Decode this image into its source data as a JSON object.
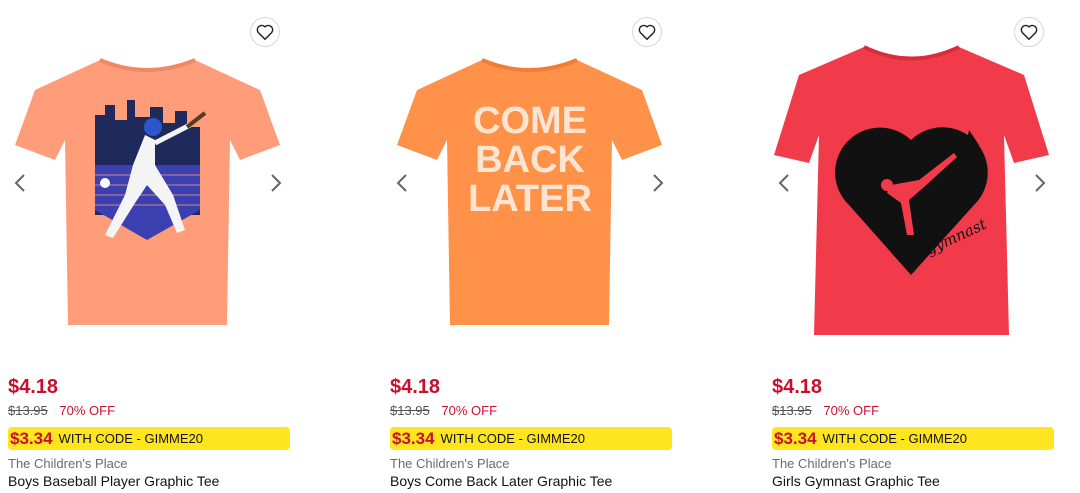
{
  "products": [
    {
      "graphic": "baseball",
      "shirt_color": "#ff9c7a",
      "price": "$4.18",
      "original_price": "$13.95",
      "discount": "70% OFF",
      "promo_price": "$3.34",
      "promo_text": "WITH CODE - GIMME20",
      "brand": "The Children's Place",
      "name": "Boys Baseball Player Graphic Tee"
    },
    {
      "graphic": "text",
      "shirt_color": "#ff9148",
      "graphic_lines": [
        "COME",
        "BACK",
        "LATER"
      ],
      "price": "$4.18",
      "original_price": "$13.95",
      "discount": "70% OFF",
      "promo_price": "$3.34",
      "promo_text": "WITH CODE - GIMME20",
      "brand": "The Children's Place",
      "name": "Boys Come Back Later Graphic Tee"
    },
    {
      "graphic": "heart",
      "shirt_color": "#f23b4a",
      "graphic_word": "gymnast",
      "price": "$4.18",
      "original_price": "$13.95",
      "discount": "70% OFF",
      "promo_price": "$3.34",
      "promo_text": "WITH CODE - GIMME20",
      "brand": "The Children's Place",
      "name": "Girls Gymnast Graphic Tee"
    }
  ],
  "icons": {
    "favorite": "heart-outline-icon",
    "prev": "chevron-left-icon",
    "next": "chevron-right-icon"
  },
  "colors": {
    "sale_red": "#c8102e",
    "promo_yellow": "#ffe51f"
  }
}
